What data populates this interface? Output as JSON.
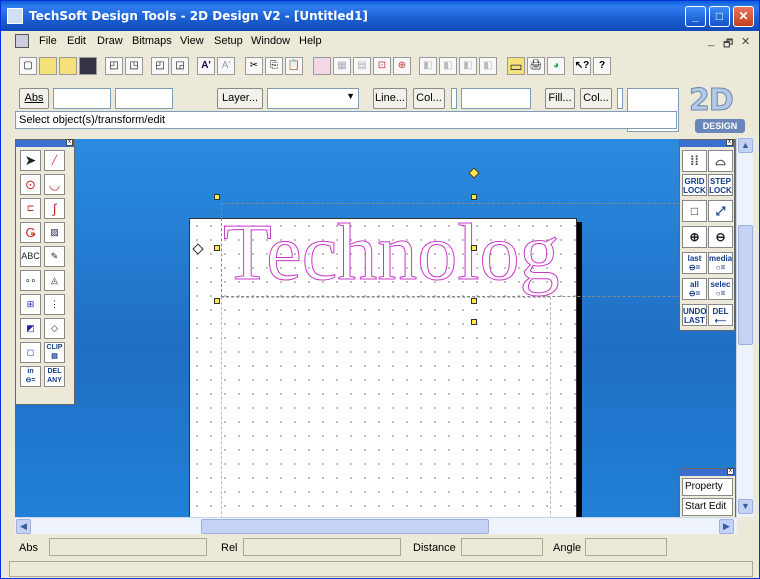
{
  "window": {
    "title": "TechSoft Design Tools - 2D Design V2 - [Untitled1]",
    "min": "_",
    "max": "□",
    "close": "✕"
  },
  "menu": {
    "items": [
      "File",
      "Edit",
      "Draw",
      "Bitmaps",
      "View",
      "Setup",
      "Window",
      "Help"
    ],
    "mdi_min": "_",
    "mdi_restore": "🗗",
    "mdi_close": "✕"
  },
  "toolbar": {
    "buttons": [
      "new",
      "open",
      "open-template",
      "save",
      "print-preview",
      "copy-format",
      "group",
      "ungroup",
      "text",
      "text-edit",
      "cut",
      "copy",
      "paste",
      "snap",
      "grid",
      "align",
      "move",
      "rotate",
      "layer1",
      "layer2",
      "layer3",
      "layer4",
      "rectangle",
      "print",
      "palette",
      "help-pointer",
      "help"
    ]
  },
  "fields": {
    "abs_label": "Abs",
    "layer_button": "Layer...",
    "line_button": "Line...",
    "col_button1": "Col...",
    "fill_button": "Fill...",
    "col_button2": "Col..."
  },
  "status": {
    "message": "Select object(s)/transform/edit"
  },
  "logo": {
    "big": "2D",
    "small": "DESIGN"
  },
  "canvas": {
    "text": "Technolog"
  },
  "left_palette": {
    "tools": [
      "select",
      "line",
      "circle",
      "arc",
      "rectangle",
      "curve",
      "offset",
      "hatch",
      "text",
      "text-edit",
      "dimension",
      "tangent",
      "group",
      "edit-points",
      "fill",
      "erase",
      "polygon",
      "clip",
      "in",
      "del-any"
    ],
    "labels": {
      "text": "ABC",
      "clip": "CLIP",
      "in": "in",
      "del": "DEL",
      "any": "ANY"
    }
  },
  "right_palette": {
    "grid": "GRID",
    "lock": "LOCK",
    "step": "STEP",
    "lock2": "LOCK",
    "last": "last",
    "media": "media",
    "all": "all",
    "selec": "selec",
    "undo": "UNDO",
    "last2": "LAST",
    "del": "DEL"
  },
  "property": {
    "property_label": "Property",
    "start_edit_label": "Start Edit"
  },
  "statusbar": {
    "abs": "Abs",
    "rel": "Rel",
    "distance": "Distance",
    "angle": "Angle"
  }
}
